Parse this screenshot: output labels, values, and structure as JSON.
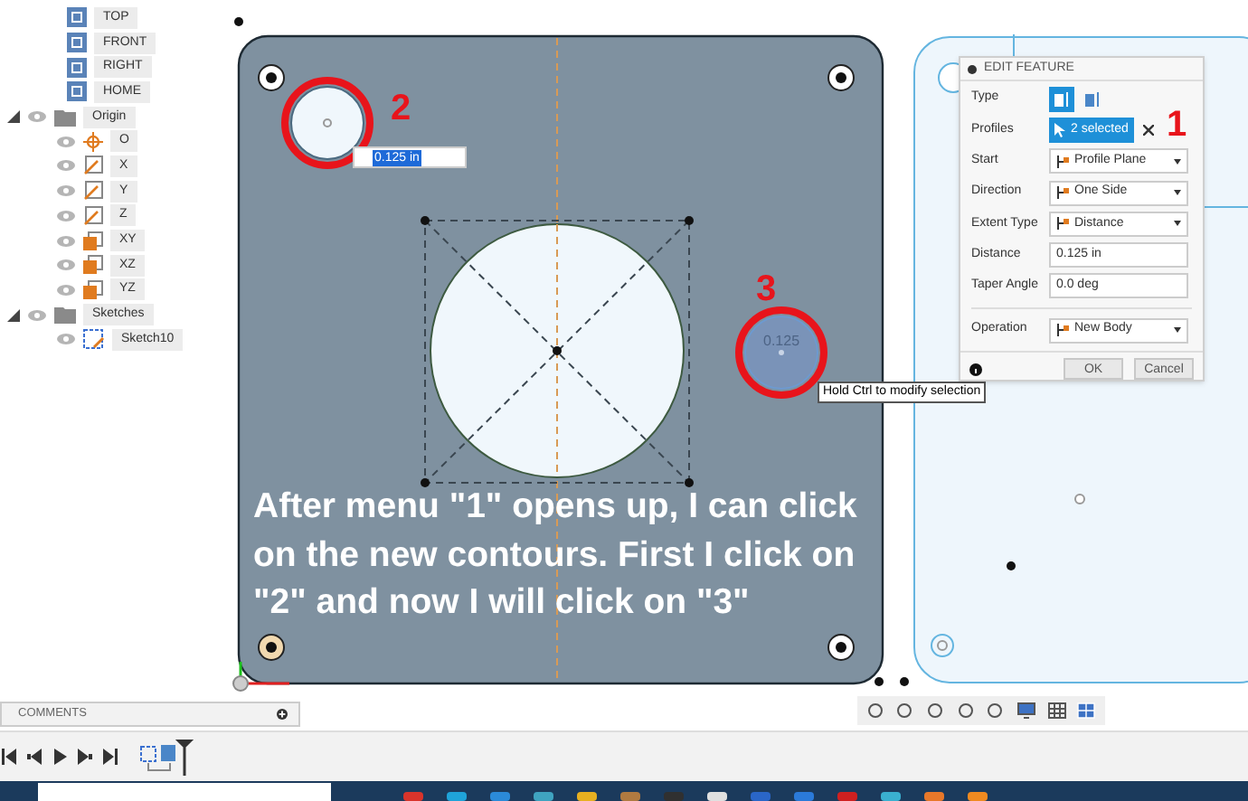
{
  "browser": {
    "items": [
      {
        "label": "TOP",
        "kind": "view"
      },
      {
        "label": "FRONT",
        "kind": "view"
      },
      {
        "label": "RIGHT",
        "kind": "view"
      },
      {
        "label": "HOME",
        "kind": "view"
      },
      {
        "label": "Origin",
        "kind": "folder",
        "expanded": true,
        "children": [
          {
            "label": "O",
            "kind": "point"
          },
          {
            "label": "X",
            "kind": "axis"
          },
          {
            "label": "Y",
            "kind": "axis"
          },
          {
            "label": "Z",
            "kind": "axis"
          },
          {
            "label": "XY",
            "kind": "plane"
          },
          {
            "label": "XZ",
            "kind": "plane"
          },
          {
            "label": "YZ",
            "kind": "plane"
          }
        ]
      },
      {
        "label": "Sketches",
        "kind": "folder",
        "expanded": true,
        "children": [
          {
            "label": "Sketch10",
            "kind": "sketch"
          }
        ]
      }
    ]
  },
  "canvas": {
    "markers": [
      {
        "label": "2"
      },
      {
        "label": "3"
      }
    ],
    "dimension_input": {
      "value": "0.125 in"
    },
    "hover_dimension": "0.125",
    "tooltip": "Hold Ctrl to modify selection",
    "caption": "After menu \"1\" opens up, I can click on the new contours. First I click on \"2\" and now I will click on \"3\""
  },
  "dialog": {
    "title": "EDIT FEATURE",
    "marker": "1",
    "type_options": [
      {
        "selected": true
      },
      {
        "selected": false
      }
    ],
    "rows": [
      {
        "label": "Type",
        "kind": "type"
      },
      {
        "label": "Profiles",
        "kind": "selection",
        "value": "2 selected"
      },
      {
        "label": "Start",
        "kind": "dropdown",
        "value": "Profile Plane"
      },
      {
        "label": "Direction",
        "kind": "dropdown",
        "value": "One Side"
      },
      {
        "label": "Extent Type",
        "kind": "dropdown",
        "value": "Distance"
      },
      {
        "label": "Distance",
        "kind": "input",
        "value": "0.125 in"
      },
      {
        "label": "Taper Angle",
        "kind": "input",
        "value": "0.0 deg"
      },
      {
        "label": "Operation",
        "kind": "dropdown",
        "value": "New Body"
      }
    ],
    "buttons": [
      "OK",
      "Cancel"
    ]
  },
  "comments": {
    "label": "COMMENTS"
  }
}
